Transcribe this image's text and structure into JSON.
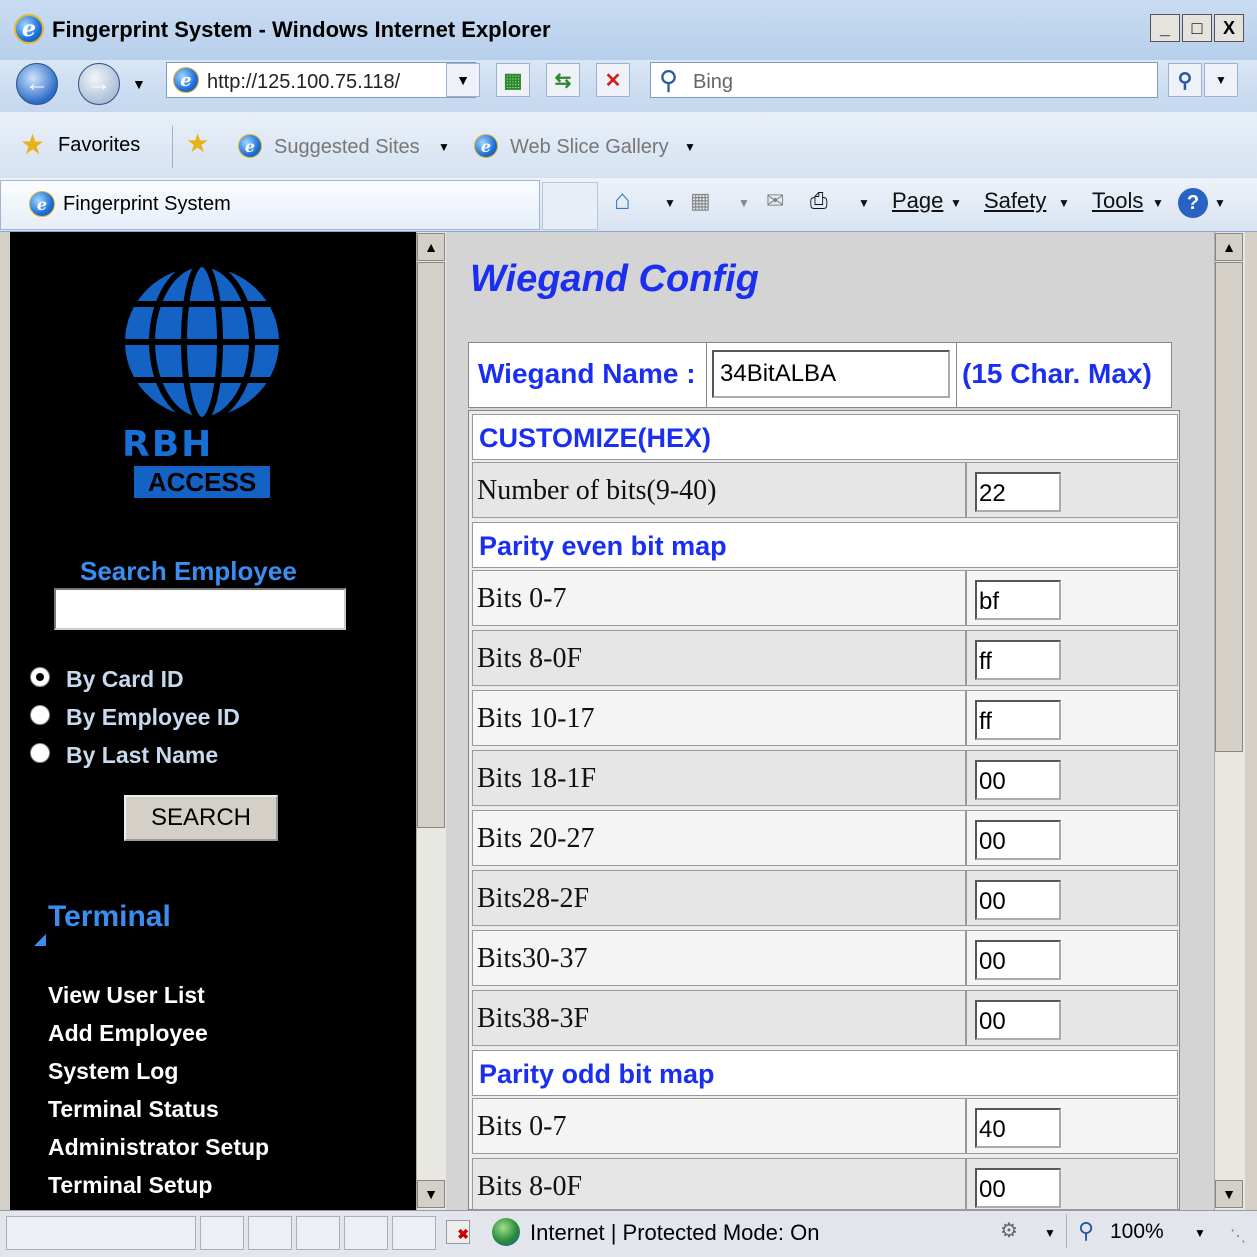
{
  "window": {
    "title": "Fingerprint System - Windows Internet Explorer",
    "minimize": "_",
    "maximize": "□",
    "close": "X"
  },
  "nav": {
    "address": "http://125.100.75.118/",
    "search_placeholder": "Bing"
  },
  "favorites_bar": {
    "favorites": "Favorites",
    "suggested_sites": "Suggested Sites",
    "web_slice_gallery": "Web Slice Gallery"
  },
  "tab": {
    "title": "Fingerprint System"
  },
  "commands": {
    "page": "Page",
    "safety": "Safety",
    "tools": "Tools"
  },
  "sidebar": {
    "logo_text": "RBH",
    "logo_sub": "ACCESS",
    "search_label": "Search Employee",
    "search_value": "",
    "radios": [
      {
        "label": "By Card ID",
        "checked": true
      },
      {
        "label": "By Employee ID",
        "checked": false
      },
      {
        "label": "By Last Name",
        "checked": false
      }
    ],
    "search_button": "SEARCH",
    "section_title": "Terminal",
    "menu": [
      "View User List",
      "Add Employee",
      "System Log",
      "Terminal Status",
      "Administrator Setup",
      "Terminal Setup"
    ]
  },
  "main": {
    "title": "Wiegand Config",
    "name_label": "Wiegand Name :",
    "name_value": "34BitALBA",
    "name_max": "(15 Char. Max)",
    "customize_header": "CUSTOMIZE(HEX)",
    "num_bits_label": "Number of bits(9-40)",
    "num_bits_value": "22",
    "even_header": "Parity even bit map",
    "even_rows": [
      {
        "label": "Bits 0-7",
        "value": "bf"
      },
      {
        "label": "Bits 8-0F",
        "value": "ff"
      },
      {
        "label": "Bits 10-17",
        "value": "ff"
      },
      {
        "label": "Bits 18-1F",
        "value": "00"
      },
      {
        "label": "Bits 20-27",
        "value": "00"
      },
      {
        "label": "Bits28-2F",
        "value": "00"
      },
      {
        "label": "Bits30-37",
        "value": "00"
      },
      {
        "label": "Bits38-3F",
        "value": "00"
      }
    ],
    "odd_header": "Parity odd bit map",
    "odd_rows": [
      {
        "label": "Bits 0-7",
        "value": "40"
      },
      {
        "label": "Bits 8-0F",
        "value": "00"
      }
    ]
  },
  "status": {
    "zone": "Internet | Protected Mode: On",
    "zoom": "100%"
  }
}
